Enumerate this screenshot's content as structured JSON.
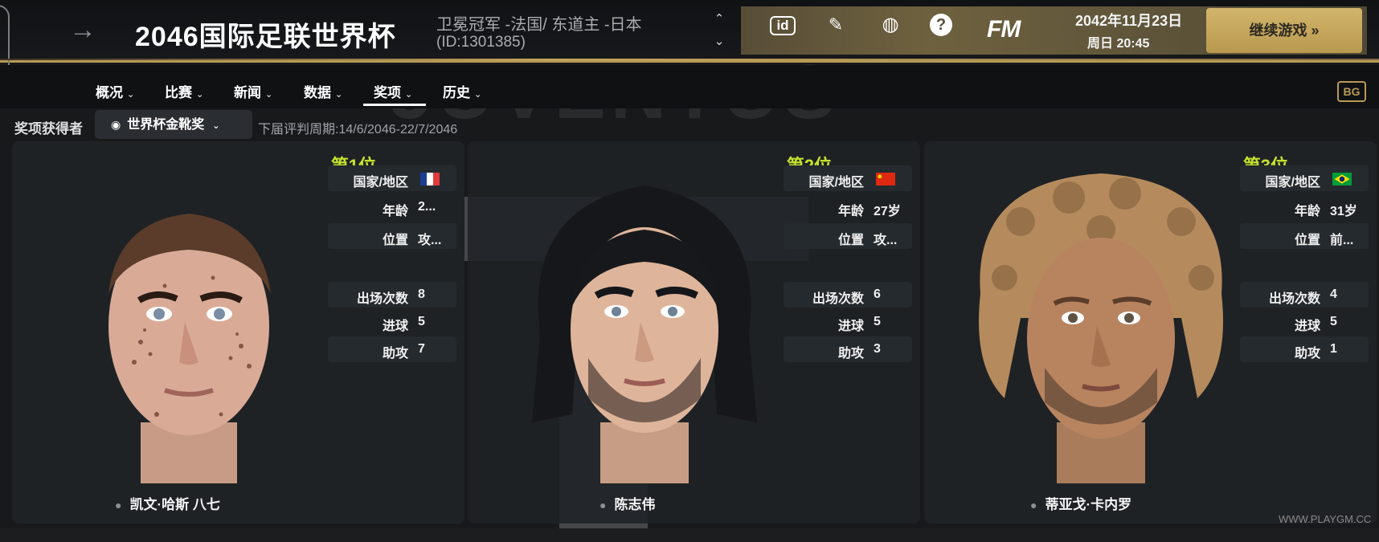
{
  "header": {
    "title": "2046国际足联世界杯",
    "subtitle_line1": "卫冕冠军 -法国/ 东道主 -日本",
    "subtitle_line2": "(ID:1301385)",
    "date": "2042年11月23日",
    "time": "周日 20:45",
    "continue_label": "继续游戏 »",
    "fm_logo": "FM",
    "icons": [
      "back-arrow-icon",
      "up-icon",
      "down-icon",
      "id-icon",
      "pencil-icon",
      "globe-icon",
      "help-icon"
    ]
  },
  "nav": {
    "items": [
      {
        "label": "概况"
      },
      {
        "label": "比赛"
      },
      {
        "label": "新闻"
      },
      {
        "label": "数据"
      },
      {
        "label": "奖项"
      },
      {
        "label": "历史"
      }
    ],
    "active": "奖项",
    "bg_logo": "BG",
    "club_watermark": "JUVENTUS"
  },
  "filter": {
    "label": "奖项获得者",
    "selected_award": "世界杯金靴奖",
    "period": "下届评判周期:14/6/2046-22/7/2046"
  },
  "winners": [
    {
      "rank": "第1位",
      "name": "凯文·哈斯 八七",
      "rows": {
        "country_label": "国家/地区",
        "age_label": "年龄",
        "age": "2...",
        "position_label": "位置",
        "position": "攻...",
        "apps_label": "出场次数",
        "apps": "8",
        "goals_label": "进球",
        "goals": "5",
        "assists_label": "助攻",
        "assists": "7"
      },
      "flag": "france"
    },
    {
      "rank": "第2位",
      "name": "陈志伟",
      "rows": {
        "country_label": "国家/地区",
        "age_label": "年龄",
        "age": "27岁",
        "position_label": "位置",
        "position": "攻...",
        "apps_label": "出场次数",
        "apps": "6",
        "goals_label": "进球",
        "goals": "5",
        "assists_label": "助攻",
        "assists": "3"
      },
      "flag": "china"
    },
    {
      "rank": "第3位",
      "name": "蒂亚戈·卡内罗",
      "rows": {
        "country_label": "国家/地区",
        "age_label": "年龄",
        "age": "31岁",
        "position_label": "位置",
        "position": "前...",
        "apps_label": "出场次数",
        "apps": "4",
        "goals_label": "进球",
        "goals": "5",
        "assists_label": "助攻",
        "assists": "1"
      },
      "flag": "brazil"
    }
  ],
  "watermark_site": "WWW.PLAYGM.CC",
  "colors": {
    "accent_gold": "#b89a55",
    "rank_green": "#c3e22d",
    "button_gold": "#d2b56c"
  }
}
